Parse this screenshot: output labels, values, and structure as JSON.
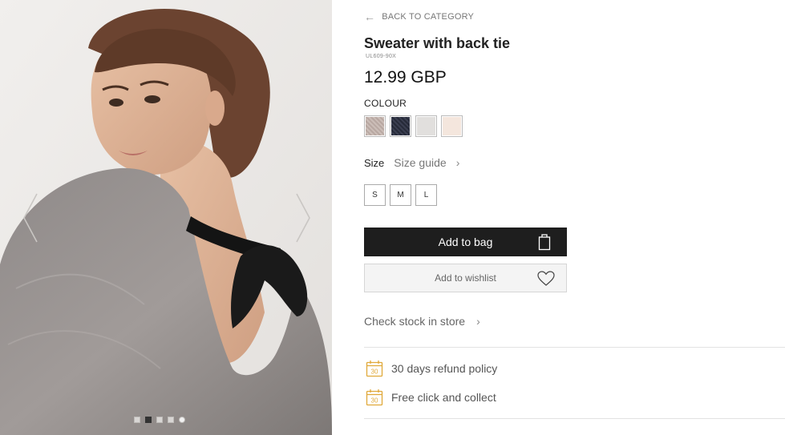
{
  "gallery": {
    "prev_arrow": "chevron-left-icon",
    "next_arrow": "chevron-right-icon",
    "dots": [
      {
        "active": false
      },
      {
        "active": true
      },
      {
        "active": false
      },
      {
        "active": false
      },
      {
        "active": false
      }
    ]
  },
  "nav": {
    "back_label": "BACK TO CATEGORY",
    "back_arrow": "←"
  },
  "product": {
    "title": "Sweater with back tie",
    "sku": "UL609-90X",
    "price": "12.99 GBP"
  },
  "colour": {
    "label": "COLOUR",
    "swatches": [
      {
        "name": "taupe",
        "color": "#b9aaa4"
      },
      {
        "name": "navy",
        "color": "#2a2d3c"
      },
      {
        "name": "light-grey",
        "color": "#e2e0de"
      },
      {
        "name": "blush",
        "color": "#f3e5dc"
      }
    ]
  },
  "size": {
    "label": "Size",
    "guide_label": "Size guide",
    "options": [
      "S",
      "M",
      "L"
    ]
  },
  "actions": {
    "add_to_bag": "Add to bag",
    "add_to_wishlist": "Add to wishlist",
    "check_stock": "Check stock in store"
  },
  "perks": [
    {
      "label": "30 days refund policy",
      "badge": "30",
      "icon": "calendar-icon"
    },
    {
      "label": "Free click and collect",
      "badge": "30",
      "icon": "calendar-icon"
    }
  ],
  "colors": {
    "accent": "#e0a93a",
    "button_dark": "#1e1e1e"
  }
}
